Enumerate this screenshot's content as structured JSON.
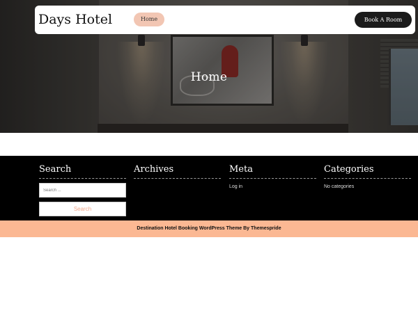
{
  "header": {
    "site_title": "Days Hotel",
    "nav": {
      "home_label": "Home"
    },
    "book_button_label": "Book A Room"
  },
  "hero": {
    "title": "Home"
  },
  "footer": {
    "widgets": {
      "search": {
        "title": "Search",
        "placeholder": "Search ...",
        "button_label": "Search"
      },
      "archives": {
        "title": "Archives"
      },
      "meta": {
        "title": "Meta",
        "items": [
          "Log in"
        ]
      },
      "categories": {
        "title": "Categories",
        "empty_text": "No categories"
      }
    },
    "credit": "Destination Hotel Booking WordPress Theme By Themespride"
  },
  "colors": {
    "accent_peach": "#fbb893",
    "nav_pill": "#f2c6b3",
    "footer_bg": "#000000",
    "button_dark": "#1b1b1b"
  }
}
